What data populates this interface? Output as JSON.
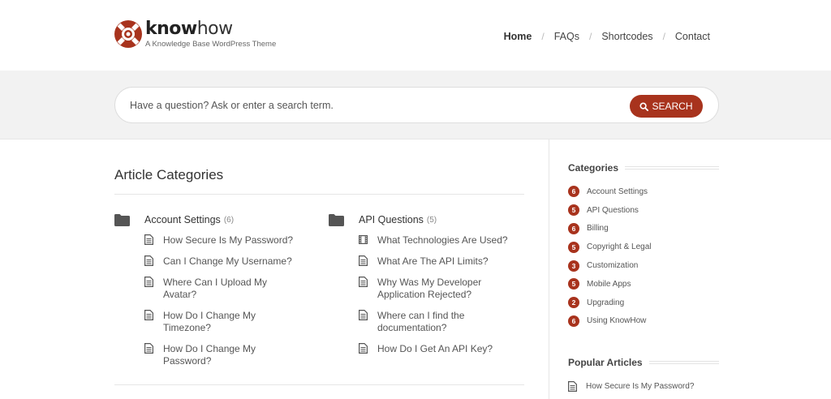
{
  "brand": {
    "name_bold": "know",
    "name_light": "how",
    "tagline": "A Knowledge Base WordPress Theme",
    "accent_color": "#a8331d"
  },
  "nav": {
    "items": [
      {
        "label": "Home",
        "active": true
      },
      {
        "label": "FAQs",
        "active": false
      },
      {
        "label": "Shortcodes",
        "active": false
      },
      {
        "label": "Contact",
        "active": false
      }
    ],
    "separator": "/"
  },
  "search": {
    "placeholder": "Have a question? Ask or enter a search term.",
    "button_label": "SEARCH",
    "button_icon": "search-icon"
  },
  "main": {
    "title": "Article Categories",
    "categories": [
      {
        "title": "Account Settings",
        "count": "(6)",
        "icon": "folder-icon",
        "articles": [
          {
            "label": "How Secure Is My Password?",
            "icon": "document-icon"
          },
          {
            "label": "Can I Change My Username?",
            "icon": "document-icon"
          },
          {
            "label": "Where Can I Upload My Avatar?",
            "icon": "document-icon"
          },
          {
            "label": "How Do I Change My Timezone?",
            "icon": "document-icon"
          },
          {
            "label": "How Do I Change My Password?",
            "icon": "document-icon"
          }
        ]
      },
      {
        "title": "API Questions",
        "count": "(5)",
        "icon": "folder-icon",
        "articles": [
          {
            "label": "What Technologies Are Used?",
            "icon": "video-icon"
          },
          {
            "label": "What Are The API Limits?",
            "icon": "document-icon"
          },
          {
            "label": "Why Was My Developer Application Rejected?",
            "icon": "document-icon"
          },
          {
            "label": "Where can I find the documentation?",
            "icon": "document-icon"
          },
          {
            "label": "How Do I Get An API Key?",
            "icon": "document-icon"
          }
        ]
      }
    ]
  },
  "sidebar": {
    "categories_heading": "Categories",
    "categories": [
      {
        "count": "6",
        "label": "Account Settings"
      },
      {
        "count": "5",
        "label": "API Questions"
      },
      {
        "count": "6",
        "label": "Billing"
      },
      {
        "count": "5",
        "label": "Copyright & Legal"
      },
      {
        "count": "3",
        "label": "Customization"
      },
      {
        "count": "5",
        "label": "Mobile Apps"
      },
      {
        "count": "2",
        "label": "Upgrading"
      },
      {
        "count": "6",
        "label": "Using KnowHow"
      }
    ],
    "popular_heading": "Popular Articles",
    "popular": [
      {
        "label": "How Secure Is My Password?",
        "icon": "document-icon"
      }
    ]
  }
}
